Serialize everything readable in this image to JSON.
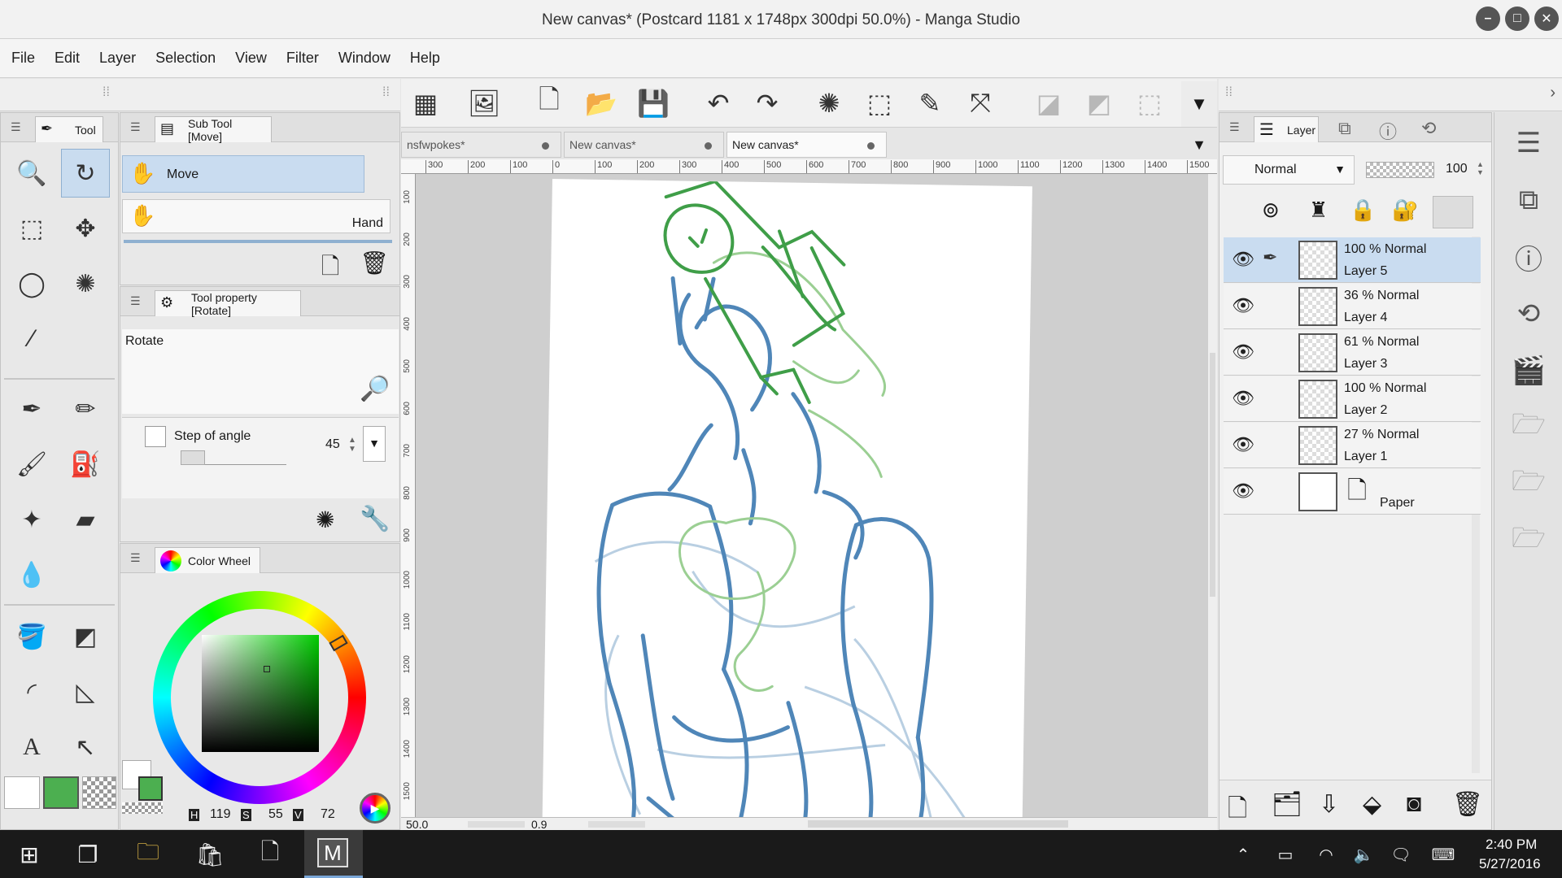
{
  "window": {
    "title": "New canvas* (Postcard 1181 x 1748px 300dpi 50.0%)  - Manga Studio"
  },
  "menu": [
    "File",
    "Edit",
    "Layer",
    "Selection",
    "View",
    "Filter",
    "Window",
    "Help"
  ],
  "tool_panel": {
    "tab": "Tool"
  },
  "subtool_panel": {
    "tab": "Sub Tool [Move]",
    "items": [
      "Move",
      "Hand"
    ]
  },
  "tool_property": {
    "tab": "Tool property [Rotate]",
    "name": "Rotate",
    "step_label": "Step of angle",
    "step_value": "45"
  },
  "color_wheel": {
    "tab": "Color Wheel",
    "h": "119",
    "s": "55",
    "v": "72",
    "h_label": "H",
    "s_label": "S",
    "v_label": "V",
    "main_color": "#4caf50"
  },
  "doc_tabs": [
    "nsfwpokes*",
    "New canvas*",
    "New canvas*"
  ],
  "ruler": {
    "top": [
      "300",
      "200",
      "100",
      "0",
      "100",
      "200",
      "300",
      "400",
      "500",
      "600",
      "700",
      "800",
      "900",
      "1000",
      "1100",
      "1200",
      "1300",
      "1400",
      "1500"
    ],
    "left": [
      "100",
      "200",
      "300",
      "400",
      "500",
      "600",
      "700",
      "800",
      "900",
      "1000",
      "1100",
      "1200",
      "1300",
      "1400",
      "1500"
    ]
  },
  "status": {
    "zoom": "50.0",
    "angle": "0.9"
  },
  "layer_panel": {
    "tab": "Layer",
    "blend_mode": "Normal",
    "opacity": "100",
    "layers": [
      {
        "line1": "100 %  Normal",
        "line2": "Layer 5",
        "selected": true
      },
      {
        "line1": "36 %  Normal",
        "line2": "Layer 4"
      },
      {
        "line1": "61 %  Normal",
        "line2": "Layer 3"
      },
      {
        "line1": "100 %  Normal",
        "line2": "Layer 2"
      },
      {
        "line1": "27 %  Normal",
        "line2": "Layer 1"
      },
      {
        "line1": "",
        "line2": "Paper"
      }
    ]
  },
  "taskbar": {
    "time": "2:40 PM",
    "date": "5/27/2016"
  }
}
